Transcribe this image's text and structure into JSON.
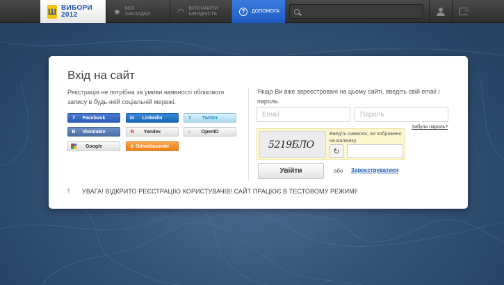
{
  "header": {
    "logo_text_line1": "ВИБОРИ",
    "logo_text_line2": "2012",
    "nav": {
      "favorites_line1": "МОЇ",
      "favorites_line2": "ЗАКЛАДКИ",
      "speed_line1": "ВИЗНАЧИТИ",
      "speed_line2": "ШВИДКІСТЬ",
      "help": "ДОПОМОГА"
    },
    "search": {
      "value": "",
      "placeholder": ""
    }
  },
  "login": {
    "title": "Вхід на сайт",
    "social_note": "Реєстрація не потрібна за умови наявності облікового запису в будь-якій соціальній мережі.",
    "social_buttons": {
      "facebook": "Facebook",
      "linkedin": "Linkedin",
      "twitter": "Twitter",
      "vkontakte": "Vkontakte",
      "yandex": "Yandex",
      "openid": "OpenID",
      "google": "Google",
      "odnoklassniki": "Odnoklassniki"
    },
    "login_note": "Якщо Ви вже зареєстровані на цьому сайті, введіть свій email і пароль.",
    "email_placeholder": "Email",
    "password_placeholder": "Пароль",
    "forgot_password": "Забули пароль?",
    "captcha": {
      "text": "5219БЛО",
      "hint": "Введіть символи, які зображено на малюнку."
    },
    "login_button": "Увійти",
    "or_text": "або",
    "register_link": "Зареєструватися",
    "warning": "УВАГА! ВІДКРИТО РЕЄСТРАЦІЮ КОРИСТУВАЧІВ! САЙТ ПРАЦЮЄ В ТЕСТОВОМУ РЕЖИМІ!"
  },
  "colors": {
    "accent_blue": "#1e5cc4",
    "topbar": "#3a3a3a",
    "background": "#345274",
    "odnoklassniki": "#f07e14"
  }
}
